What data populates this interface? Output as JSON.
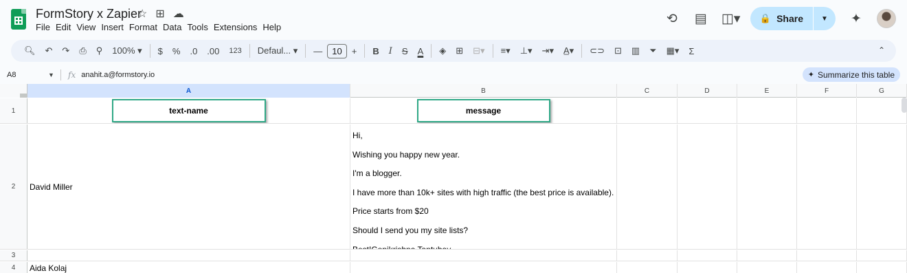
{
  "app": {
    "title": "FormStory x Zapier",
    "menu": [
      "File",
      "Edit",
      "View",
      "Insert",
      "Format",
      "Data",
      "Tools",
      "Extensions",
      "Help"
    ],
    "share_label": "Share"
  },
  "toolbar": {
    "zoom": "100%",
    "currency": "$",
    "percent": "%",
    "dec_decrease": ".0",
    "dec_increase": ".00",
    "number_format": "123",
    "font": "Defaul...",
    "font_size": "10",
    "bold": "B",
    "italic": "I",
    "strike": "S",
    "text_color": "A",
    "sum": "Σ"
  },
  "formula_bar": {
    "cell_ref": "A8",
    "fx": "fx",
    "value": "anahit.a@formstory.io",
    "summarize_label": "Summarize this table"
  },
  "grid": {
    "columns": [
      "A",
      "B",
      "C",
      "D",
      "E",
      "F",
      "G"
    ],
    "selected_column": "A",
    "rows": [
      {
        "num": "1",
        "a": "text-name",
        "b": "message"
      },
      {
        "num": "2",
        "a": "David Miller",
        "b_lines": [
          "Hi,",
          "Wishing you happy new year.",
          "I'm a blogger.",
          "I have more than 10k+ sites with high traffic (the best price is available).",
          "Price starts from $20",
          "Should I send you my site lists?",
          "Best!Gopikrishna Tantubay"
        ]
      },
      {
        "num": "3",
        "a": "",
        "b": ""
      },
      {
        "num": "4",
        "a": "Aida Kolaj",
        "b": ""
      }
    ]
  },
  "colors": {
    "accent": "#0b57d0",
    "share_bg": "#c2e7ff",
    "header_outline": "#2fa886",
    "sheets_green": "#0f9d58"
  },
  "icons": [
    "search-icon",
    "undo-icon",
    "redo-icon",
    "print-icon",
    "paint-format-icon",
    "history-icon",
    "comment-icon",
    "meet-icon",
    "gemini-icon",
    "lock-icon",
    "star-icon",
    "move-icon",
    "cloud-icon"
  ]
}
